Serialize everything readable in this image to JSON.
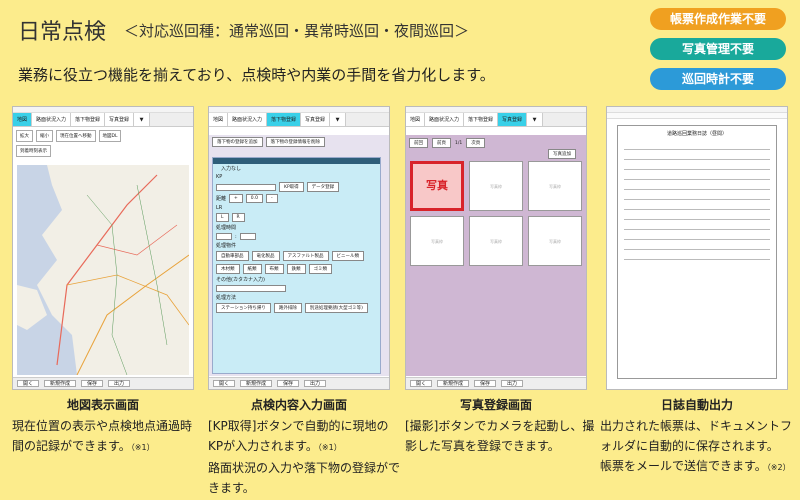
{
  "header": {
    "title": "日常点検",
    "subtitle": "＜対応巡回種：通常巡回・異常時巡回・夜間巡回＞",
    "lead": "業務に役立つ機能を揃えており、点検時や内業の手間を省力化します。"
  },
  "badges": [
    {
      "label": "帳票作成作業不要",
      "color": "#f0a020"
    },
    {
      "label": "写真管理不要",
      "color": "#19a99b"
    },
    {
      "label": "巡回時計不要",
      "color": "#2c9ad8"
    }
  ],
  "common": {
    "footer": [
      "開く",
      "新規作成",
      "保存",
      "出力"
    ]
  },
  "screen1": {
    "tabs": [
      "地図",
      "路面状況入力",
      "落下物登録",
      "写真登録",
      "▼"
    ],
    "buttons": [
      "拡大",
      "縮小",
      "現在位置へ移動",
      "地図DL",
      "到着時刻表示"
    ]
  },
  "screen2": {
    "tabs": [
      "地図",
      "路面状況入力",
      "落下物登録",
      "写真登録",
      "▼"
    ],
    "top_buttons": [
      "落下物の登録を追加",
      "落下物の登録情報を削除"
    ],
    "none_label": "入力なし",
    "kp_label": "KP",
    "kp_button": "KP取得",
    "data_button": "データ登録",
    "distance_label": "距離",
    "plus": "+",
    "distance_value": "0.0",
    "minus": "-",
    "lr_label": "LR",
    "l": "L",
    "r": "R",
    "time_label": "処理時間",
    "colon": ":",
    "items_label": "処理物件",
    "items": [
      "自動車部品",
      "竜化製品",
      "アスファルト製品",
      "ビニール類",
      "木材類",
      "紙類",
      "布類",
      "鉄類",
      "ゴミ類"
    ],
    "other_label": "その他(カタカナ入力)",
    "method_label": "処理方法",
    "methods": [
      "ステーション持ち帰り",
      "路外排除",
      "別途処理要請(大型ゴミ等)"
    ]
  },
  "screen3": {
    "tabs": [
      "地図",
      "路面状況入力",
      "落下物登録",
      "写真登録",
      "▼"
    ],
    "nav": [
      "前回",
      "前頁",
      "1/1",
      "次頁"
    ],
    "add_button": "写真追加",
    "photo_label": "写真",
    "cell_label": "写真枠"
  },
  "screen4": {
    "doc_title": "道路巡回業務日誌（昼間）"
  },
  "captions": [
    "地図表示画面",
    "点検内容入力画面",
    "写真登録画面",
    "日誌自動出力"
  ],
  "descs": {
    "d1": {
      "text": "現在位置の表示や点検地点通過時間の記録ができます。",
      "note": "（※1）"
    },
    "d2": {
      "text1": "[KP取得]ボタンで自動的に現地のKPが入力されます。",
      "note": "（※1）",
      "text2": "路面状況の入力や落下物の登録ができます。"
    },
    "d3": {
      "text": "[撮影]ボタンでカメラを起動し、撮影した写真を登録できます。"
    },
    "d4": {
      "text1": "出力された帳票は、ドキュメントフォルダに自動的に保存されます。",
      "text2": "帳票をメールで送信できます。",
      "note": "（※2）"
    }
  }
}
